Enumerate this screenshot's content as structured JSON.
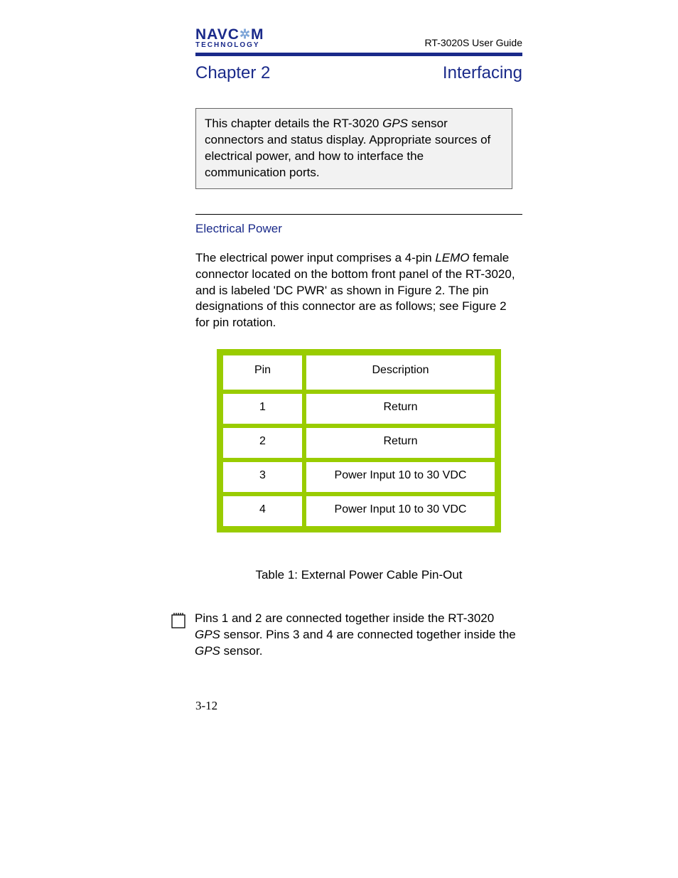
{
  "header": {
    "logo_line1_left": "NAVC",
    "logo_line1_right": "M",
    "logo_line2": "TECHNOLOGY",
    "guide_label": "RT-3020S User Guide"
  },
  "chapter": {
    "left": "Chapter 2",
    "right": "Interfacing"
  },
  "intro": {
    "pre": "This chapter details the RT-3020 ",
    "italic": "GPS",
    "post": " sensor connectors and status display. Appropriate sources of electrical power, and how to interface the communication ports."
  },
  "section_title": "Electrical Power",
  "body": {
    "pre": "The electrical power input comprises a 4-pin ",
    "italic": "LEMO",
    "post": " female connector located on the bottom front panel of the RT-3020, and is labeled 'DC PWR' as shown in Figure 2. The pin designations of this connector are as follows; see Figure 2 for pin rotation."
  },
  "table": {
    "headers": {
      "pin": "Pin",
      "desc": "Description"
    },
    "rows": [
      {
        "pin": "1",
        "desc": "Return"
      },
      {
        "pin": "2",
        "desc": "Return"
      },
      {
        "pin": "3",
        "desc": "Power Input 10 to 30 VDC"
      },
      {
        "pin": "4",
        "desc": "Power Input 10 to 30 VDC"
      }
    ],
    "caption": "Table 1: External Power Cable Pin-Out"
  },
  "note": {
    "p1": "Pins 1 and 2 are connected together inside the RT-3020 ",
    "i1": "GPS",
    "p2": " sensor. Pins 3 and 4 are connected together inside the ",
    "i2": "GPS",
    "p3": " sensor."
  },
  "page_number": "3-12"
}
